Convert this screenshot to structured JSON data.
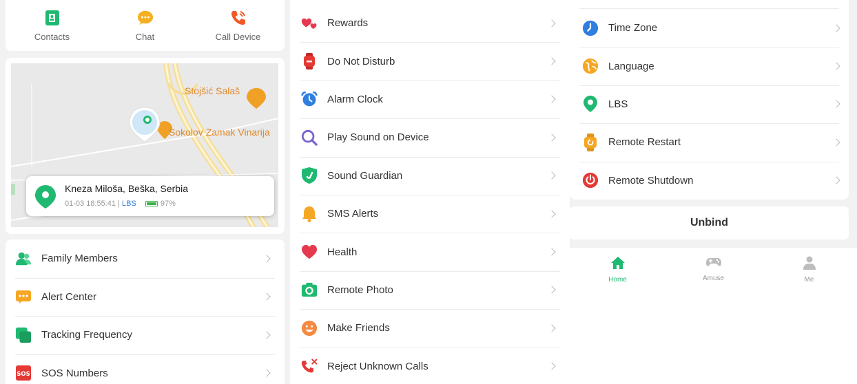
{
  "quick_actions": [
    {
      "label": "Contacts",
      "icon": "contacts-icon",
      "color": "#1fb971"
    },
    {
      "label": "Chat",
      "icon": "chat-icon",
      "color": "#f5b021"
    },
    {
      "label": "Call Device",
      "icon": "call-device-icon",
      "color": "#f05a28"
    }
  ],
  "map": {
    "pois": [
      "Stojšić Salaš",
      "Sokolov Zamak Vinarija"
    ],
    "location": {
      "address": "Kneza Miloša, Beška, Serbia",
      "time": "01-03 18:55:41 |",
      "source": "LBS",
      "battery": "97%"
    }
  },
  "menu_left": [
    {
      "label": "Family Members",
      "icon": "family-members-icon",
      "color": "#1fb971"
    },
    {
      "label": "Alert Center",
      "icon": "alert-center-icon",
      "color": "#f5a623"
    },
    {
      "label": "Tracking Frequency",
      "icon": "tracking-frequency-icon",
      "color": "#1fb971"
    },
    {
      "label": "SOS Numbers",
      "icon": "sos-icon",
      "color": "#e53935"
    }
  ],
  "menu_middle": [
    {
      "label": "Rewards",
      "icon": "rewards-icon",
      "color": "#e53950"
    },
    {
      "label": "Do Not Disturb",
      "icon": "do-not-disturb-icon",
      "color": "#e53935"
    },
    {
      "label": "Alarm Clock",
      "icon": "alarm-clock-icon",
      "color": "#2f7ee0"
    },
    {
      "label": "Play Sound on Device",
      "icon": "play-sound-icon",
      "color": "#7b61d1"
    },
    {
      "label": "Sound Guardian",
      "icon": "sound-guardian-icon",
      "color": "#1fb971"
    },
    {
      "label": "SMS Alerts",
      "icon": "sms-alerts-icon",
      "color": "#f5a623"
    },
    {
      "label": "Health",
      "icon": "health-icon",
      "color": "#e53950"
    },
    {
      "label": "Remote Photo",
      "icon": "remote-photo-icon",
      "color": "#1fb971"
    },
    {
      "label": "Make Friends",
      "icon": "make-friends-icon",
      "color": "#f58a42"
    },
    {
      "label": "Reject Unknown Calls",
      "icon": "reject-calls-icon",
      "color": "#e53935"
    }
  ],
  "menu_right": [
    {
      "label": "Time Zone",
      "icon": "time-zone-icon",
      "color": "#2f7ee0"
    },
    {
      "label": "Language",
      "icon": "language-icon",
      "color": "#f5a623"
    },
    {
      "label": "LBS",
      "icon": "lbs-icon",
      "color": "#1fb971"
    },
    {
      "label": "Remote Restart",
      "icon": "remote-restart-icon",
      "color": "#f5a623"
    },
    {
      "label": "Remote Shutdown",
      "icon": "remote-shutdown-icon",
      "color": "#e53935"
    }
  ],
  "unbind_label": "Unbind",
  "tabs": [
    {
      "label": "Home",
      "icon": "home-icon",
      "active": true
    },
    {
      "label": "Amuse",
      "icon": "gamepad-icon",
      "active": false
    },
    {
      "label": "Me",
      "icon": "person-icon",
      "active": false
    }
  ]
}
